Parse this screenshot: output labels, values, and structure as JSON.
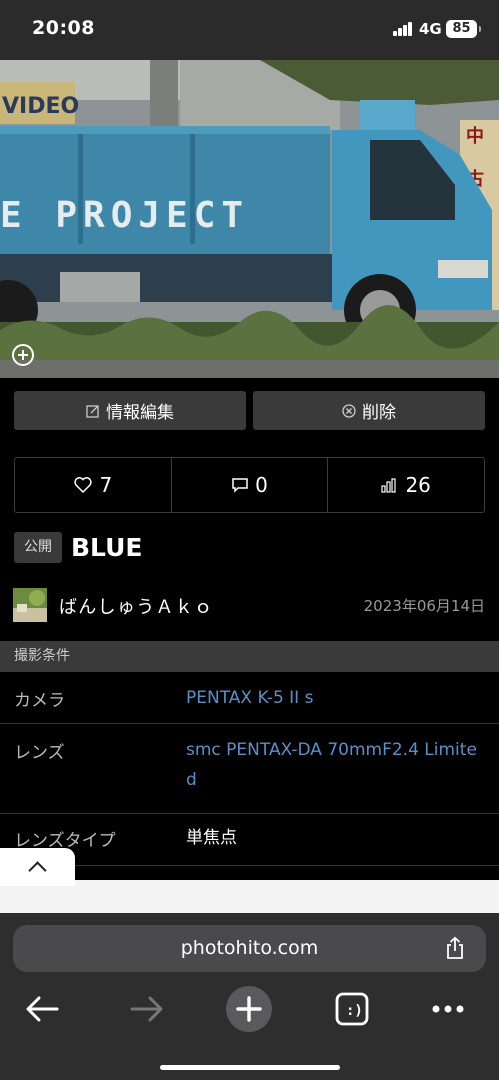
{
  "status_bar": {
    "time": "20:08",
    "network": "4G",
    "battery": "85"
  },
  "photo": {
    "description_icon": "zoom-plus-icon"
  },
  "actions": {
    "edit_label": "情報編集",
    "delete_label": "削除"
  },
  "stats": {
    "likes": "7",
    "comments": "0",
    "views": "26"
  },
  "post": {
    "visibility": "公開",
    "title": "BLUE"
  },
  "author": {
    "name": "ばんしゅうＡｋｏ",
    "date": "2023年06月14日"
  },
  "conditions": {
    "header": "撮影条件",
    "rows": [
      {
        "label": "カメラ",
        "value": "PENTAX K-5 II s"
      },
      {
        "label": "レンズ",
        "value": "smc PENTAX-DA 70mmF2.4 Limited"
      },
      {
        "label": "レンズタイプ",
        "value": "単焦点"
      }
    ]
  },
  "browser": {
    "url": "photohito.com"
  },
  "colors": {
    "link": "#5a90c8",
    "truck_blue": "#3d86a8"
  }
}
